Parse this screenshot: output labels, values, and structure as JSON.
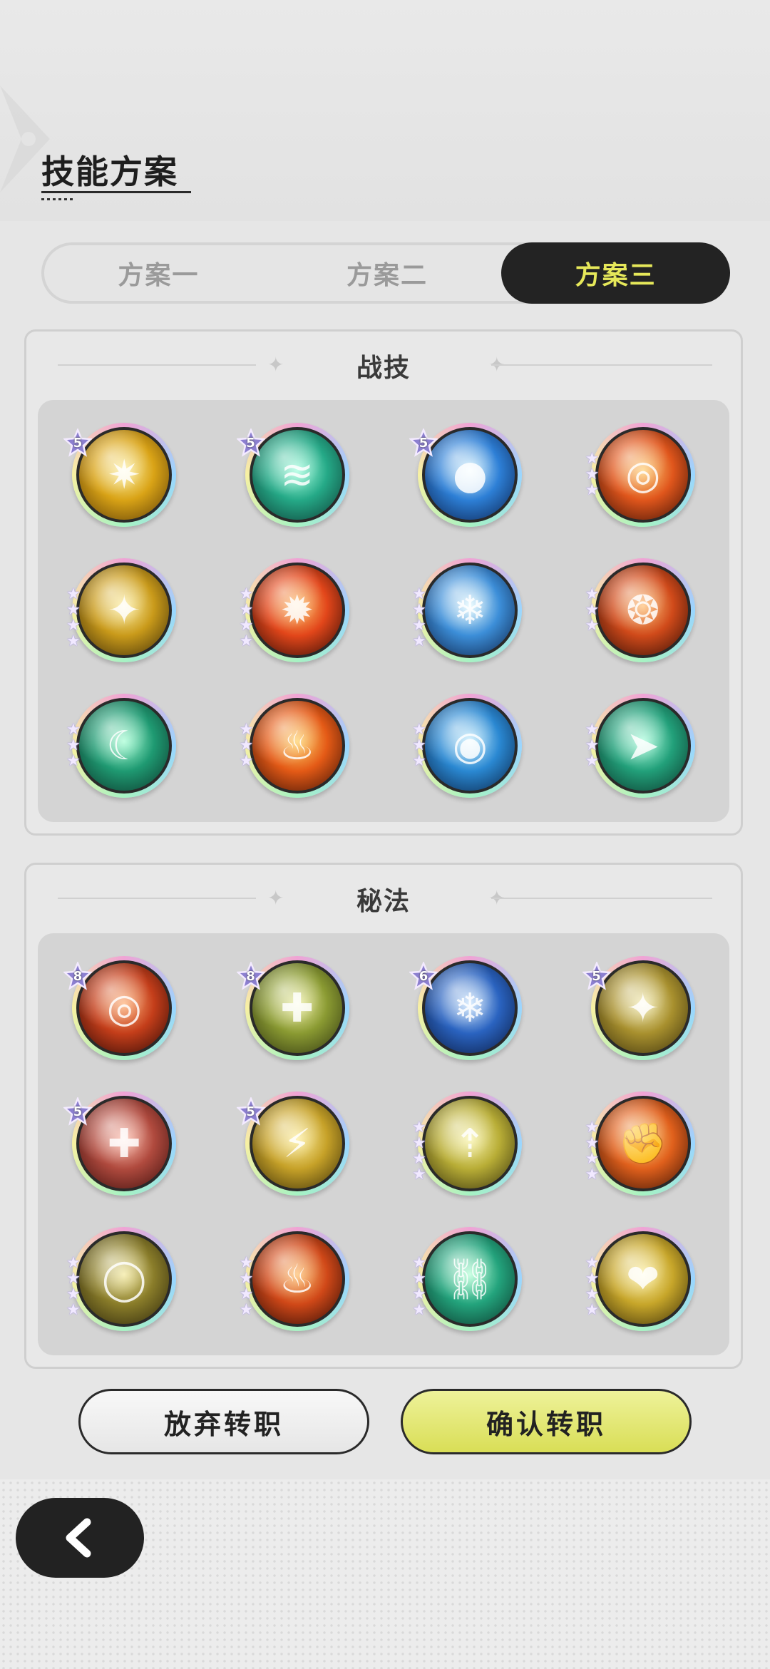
{
  "header": {
    "title": "技能方案"
  },
  "tabs": [
    {
      "label": "方案一",
      "active": false
    },
    {
      "label": "方案二",
      "active": false
    },
    {
      "label": "方案三",
      "active": true
    }
  ],
  "combat_skills": {
    "title": "战技",
    "items": [
      {
        "name": "golden-burst",
        "level": "5",
        "stars": 0,
        "colors": [
          "#fff3a8",
          "#d9a316",
          "#5a3b07"
        ],
        "glyph": "✷"
      },
      {
        "name": "jade-wind",
        "level": "5",
        "stars": 0,
        "colors": [
          "#a6ffe0",
          "#25a987",
          "#0d3b33"
        ],
        "glyph": "≋"
      },
      {
        "name": "frost-orb",
        "level": "5",
        "stars": 0,
        "colors": [
          "#d8f5ff",
          "#2d7fd6",
          "#0b1f4a"
        ],
        "glyph": "●"
      },
      {
        "name": "flame-vortex",
        "level": "",
        "stars": 3,
        "colors": [
          "#ffd27a",
          "#e0561c",
          "#3a0f05"
        ],
        "glyph": "◎"
      },
      {
        "name": "star-strike",
        "level": "",
        "stars": 4,
        "colors": [
          "#fff1a6",
          "#c99a1a",
          "#3a2a08"
        ],
        "glyph": "✦"
      },
      {
        "name": "fire-comet",
        "level": "",
        "stars": 4,
        "colors": [
          "#ffc46a",
          "#e2461a",
          "#2a0a05"
        ],
        "glyph": "✹"
      },
      {
        "name": "ice-crystals",
        "level": "",
        "stars": 4,
        "colors": [
          "#e6fbff",
          "#3c8ed8",
          "#0c2046"
        ],
        "glyph": "❄"
      },
      {
        "name": "flame-swirl",
        "level": "",
        "stars": 3,
        "colors": [
          "#ffc27a",
          "#d04a1a",
          "#2e0c05"
        ],
        "glyph": "❂"
      },
      {
        "name": "wind-slash",
        "level": "",
        "stars": 3,
        "colors": [
          "#a8ffd6",
          "#1f9a72",
          "#0b3328"
        ],
        "glyph": "☾"
      },
      {
        "name": "wildfire",
        "level": "",
        "stars": 3,
        "colors": [
          "#ffd36a",
          "#e45a16",
          "#3a1005"
        ],
        "glyph": "♨"
      },
      {
        "name": "water-vortex",
        "level": "",
        "stars": 3,
        "colors": [
          "#c8f0ff",
          "#2a88d2",
          "#0a2244"
        ],
        "glyph": "◉"
      },
      {
        "name": "gale-arrow",
        "level": "",
        "stars": 3,
        "colors": [
          "#b0ffe0",
          "#22a07a",
          "#0b362a"
        ],
        "glyph": "➤"
      }
    ]
  },
  "secret_arts": {
    "title": "秘法",
    "items": [
      {
        "name": "fire-core",
        "level": "8",
        "stars": 0,
        "colors": [
          "#ffb27a",
          "#c43e1a",
          "#2a0805"
        ],
        "glyph": "◎"
      },
      {
        "name": "healing-aura",
        "level": "8",
        "stars": 0,
        "colors": [
          "#f1f2a8",
          "#8a9a32",
          "#2e3410"
        ],
        "glyph": "✚"
      },
      {
        "name": "frost-shield",
        "level": "6",
        "stars": 0,
        "colors": [
          "#cfe8ff",
          "#2a63c0",
          "#0a1a3e"
        ],
        "glyph": "❄"
      },
      {
        "name": "golden-guard",
        "level": "5",
        "stars": 0,
        "colors": [
          "#f6efb8",
          "#a8902e",
          "#3a300c"
        ],
        "glyph": "✦"
      },
      {
        "name": "blood-boost",
        "level": "5",
        "stars": 0,
        "colors": [
          "#ffc0b0",
          "#b04a3e",
          "#3a0e0c"
        ],
        "glyph": "✚"
      },
      {
        "name": "thunder-call",
        "level": "5",
        "stars": 0,
        "colors": [
          "#fff0a0",
          "#c6a128",
          "#3a2e08"
        ],
        "glyph": "⚡"
      },
      {
        "name": "rising-power",
        "level": "",
        "stars": 4,
        "colors": [
          "#fbf6b0",
          "#b8ad36",
          "#35300c"
        ],
        "glyph": "⇡"
      },
      {
        "name": "burning-fist",
        "level": "",
        "stars": 4,
        "colors": [
          "#ffd07a",
          "#e0601c",
          "#3a1205"
        ],
        "glyph": "✊"
      },
      {
        "name": "golden-ring",
        "level": "",
        "stars": 4,
        "colors": [
          "#f4eaa0",
          "#8a7d2a",
          "#2a240a"
        ],
        "glyph": "◯"
      },
      {
        "name": "fire-spirit",
        "level": "",
        "stars": 4,
        "colors": [
          "#ffc070",
          "#d04818",
          "#2a0a05"
        ],
        "glyph": "♨"
      },
      {
        "name": "jade-chains",
        "level": "",
        "stars": 4,
        "colors": [
          "#b6ffd8",
          "#23a37c",
          "#0b362a"
        ],
        "glyph": "⛓"
      },
      {
        "name": "radiant-heart",
        "level": "",
        "stars": 4,
        "colors": [
          "#fff2a6",
          "#c7a62a",
          "#3a2e08"
        ],
        "glyph": "❤"
      }
    ]
  },
  "actions": {
    "abandon_label": "放弃转职",
    "confirm_label": "确认转职"
  },
  "colors": {
    "tab_active_bg": "#232323",
    "tab_active_text": "#e6e85a",
    "confirm_bg": "#d9de56"
  }
}
